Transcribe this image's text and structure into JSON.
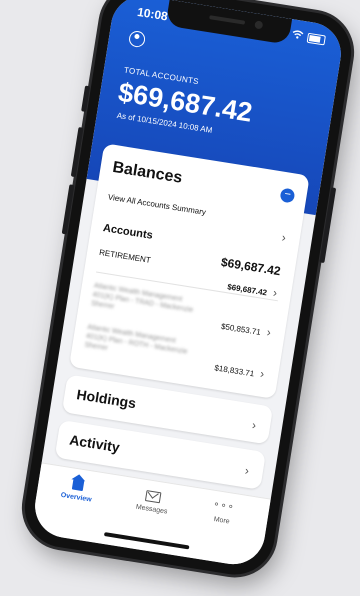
{
  "status_bar": {
    "time": "10:08"
  },
  "header": {
    "total_label": "TOTAL ACCOUNTS",
    "total_amount": "$69,687.42",
    "as_of": "As of 10/15/2024 10:08 AM"
  },
  "balances": {
    "title": "Balances",
    "collapse_symbol": "−",
    "view_all_label": "View All Accounts Summary",
    "accounts_label": "Accounts",
    "accounts_total": "$69,687.42",
    "retirement_label": "RETIREMENT",
    "retirement_total": "$69,687.42",
    "accounts": [
      {
        "name": "Atlantic Wealth Management 401(K) Plan - TRAD - Mackenzie Sherrer",
        "amount": "$50,853.71"
      },
      {
        "name": "Atlantic Wealth Management 401(K) Plan - ROTH - Mackenzie Sherrer",
        "amount": "$18,833.71"
      }
    ]
  },
  "holdings": {
    "title": "Holdings"
  },
  "activity": {
    "title": "Activity"
  },
  "tabbar": {
    "overview": "Overview",
    "messages": "Messages",
    "more": "More",
    "more_glyph": "∘∘∘"
  },
  "icons": {
    "profile": "profile-icon",
    "wifi": "wifi-icon",
    "battery": "battery-icon",
    "chevron": "chevron-right-icon",
    "home": "home-icon",
    "messages": "mail-icon",
    "more": "more-icon"
  },
  "colors": {
    "brand_blue": "#1a5fd6",
    "header_dark": "#1647b8",
    "background": "#f1f2f5"
  }
}
